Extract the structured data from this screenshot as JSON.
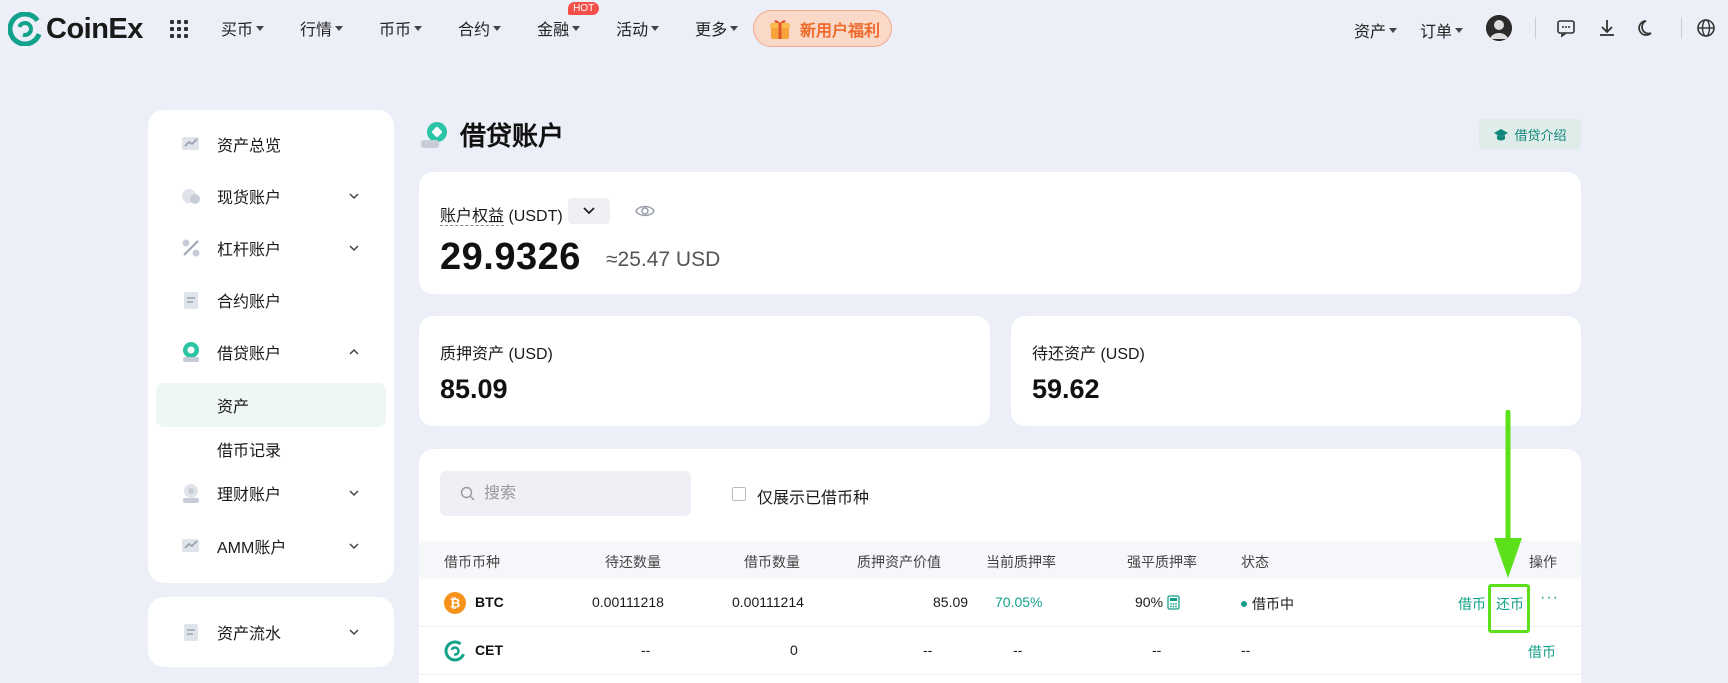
{
  "brand": {
    "name": "CoinEx",
    "color": "#12a18a"
  },
  "nav": {
    "items": [
      {
        "label": "买币"
      },
      {
        "label": "行情"
      },
      {
        "label": "币币"
      },
      {
        "label": "合约"
      },
      {
        "label": "金融",
        "badge": "HOT"
      },
      {
        "label": "活动"
      },
      {
        "label": "更多"
      }
    ],
    "promo": "新用户福利",
    "right": {
      "assets": "资产",
      "orders": "订单"
    },
    "icons": [
      "grid-icon",
      "avatar",
      "message-icon",
      "download-icon",
      "moon-icon",
      "globe-icon"
    ]
  },
  "sidebar": {
    "items": [
      {
        "label": "资产总览",
        "icon": "chart-icon"
      },
      {
        "label": "现货账户",
        "icon": "spot-icon"
      },
      {
        "label": "杠杆账户",
        "icon": "percent-icon"
      },
      {
        "label": "合约账户",
        "icon": "document-icon"
      },
      {
        "label": "借贷账户",
        "icon": "loan-icon"
      },
      {
        "label": "理财账户",
        "icon": "finance-icon"
      },
      {
        "label": "AMM账户",
        "icon": "amm-icon"
      }
    ],
    "sub": [
      {
        "label": "资产"
      },
      {
        "label": "借币记录"
      }
    ],
    "footer": {
      "label": "资产流水",
      "icon": "ledger-icon"
    }
  },
  "page": {
    "title": "借贷账户",
    "intro_button": "借贷介绍"
  },
  "equity": {
    "label": "账户权益",
    "unit": "(USDT)",
    "value": "29.9326",
    "usd_approx": "≈25.47 USD"
  },
  "collateral": {
    "label": "质押资产 (USD)",
    "value": "85.09"
  },
  "owed": {
    "label": "待还资产 (USD)",
    "value": "59.62"
  },
  "table": {
    "search_placeholder": "搜索",
    "filter_label": "仅展示已借币种",
    "headers": [
      "借币币种",
      "待还数量",
      "借币数量",
      "质押资产价值",
      "当前质押率",
      "强平质押率",
      "状态",
      "操作"
    ],
    "rows": [
      {
        "coin": "BTC",
        "owed": "0.00111218",
        "borrowed": "0.00111214",
        "collateral_value": "85.09",
        "current_ratio": "70.05%",
        "liq_ratio": "90%",
        "status": "借币中",
        "actions": [
          "借币",
          "还币"
        ],
        "more": "···"
      },
      {
        "coin": "CET",
        "owed": "--",
        "borrowed": "0",
        "collateral_value": "--",
        "current_ratio": "--",
        "liq_ratio": "--",
        "status": "--",
        "actions": [
          "借币"
        ]
      }
    ]
  },
  "colors": {
    "accent": "#12a18a",
    "promo": "#ee6a2c",
    "hot": "#f4504a",
    "annotation": "#5be01a"
  }
}
